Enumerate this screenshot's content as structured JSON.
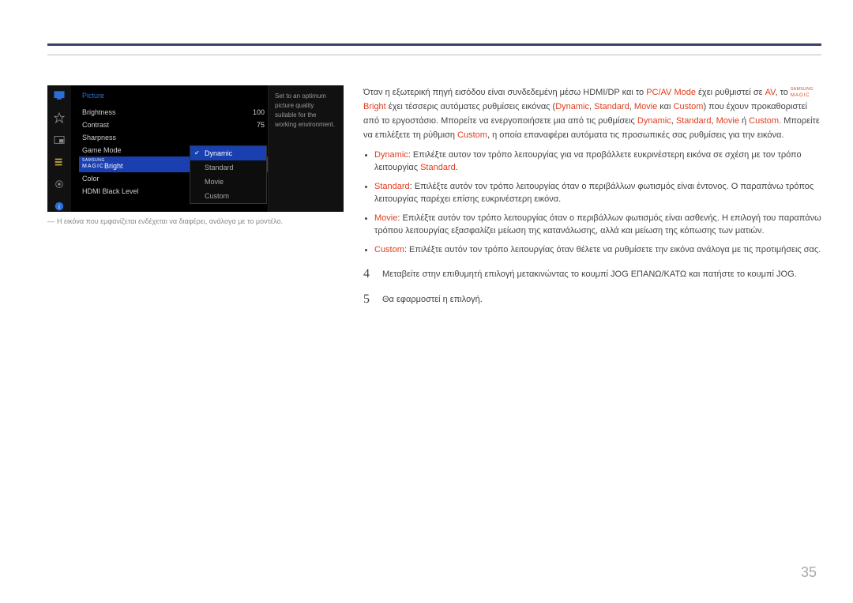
{
  "osd": {
    "title": "Picture",
    "items": [
      {
        "label": "Brightness",
        "value": "100"
      },
      {
        "label": "Contrast",
        "value": "75"
      },
      {
        "label": "Sharpness",
        "value": ""
      },
      {
        "label": "Game Mode",
        "value": ""
      },
      {
        "label_html": "magic",
        "label": "Bright",
        "value": "",
        "selected": true
      },
      {
        "label": "Color",
        "value": ""
      },
      {
        "label": "HDMI Black Level",
        "value": ""
      }
    ],
    "submenu": [
      "Dynamic",
      "Standard",
      "Movie",
      "Custom"
    ],
    "submenu_selected": 0,
    "hint": "Set to an optimum picture quality suitable for the working environment."
  },
  "caption": "Η εικόνα που εμφανίζεται ενδέχεται να διαφέρει, ανάλογα με το μοντέλο.",
  "intro": {
    "l1a": "Όταν η εξωτερική πηγή εισόδου είναι συνδεδεμένη μέσω HDMI/DP και το ",
    "l1b": "PC/AV Mode",
    "l1c": " έχει ρυθμιστεί σε ",
    "l1d": "AV",
    "l1e": ",",
    "l2a": "το ",
    "l2b": "Bright",
    "l2c": " έχει τέσσερις αυτόματες ρυθμίσεις εικόνας (",
    "l2d": "Dynamic",
    "l2e": ", ",
    "l2f": "Standard",
    "l2g": ", ",
    "l2h": "Movie",
    "l2i": " και ",
    "l2j": "Custom",
    "l2k": ") που έχουν",
    "l3a": "προκαθοριστεί από το εργοστάσιο. Μπορείτε να ενεργοποιήσετε μια από τις ρυθμίσεις ",
    "l3b": "Dynamic",
    "l3c": ", ",
    "l3d": "Standard",
    "l3e": ",",
    "l4a": "Movie",
    "l4b": " ή ",
    "l4c": "Custom",
    "l4d": ". Μπορείτε να επιλέξετε τη ρύθμιση ",
    "l4e": "Custom",
    "l4f": ", η οποία επαναφέρει αυτόματα τις προσωπικές σας",
    "l5": "ρυθμίσεις για την εικόνα."
  },
  "bullets": {
    "b1a": "Dynamic",
    "b1b": ": Επιλέξτε αυτον τον τρόπο λειτουργίας για να προβάλλετε ευκρινέστερη εικόνα σε σχέση με τον τρόπο λειτουργίας ",
    "b1c": "Standard",
    "b1d": ".",
    "b2a": "Standard",
    "b2b": ": Επιλέξτε αυτόν τον τρόπο λειτουργίας όταν ο περιβάλλων φωτισμός είναι έντονος. Ο παραπάνω τρόπος λειτουργίας παρέχει επίσης ευκρινέστερη εικόνα.",
    "b3a": "Movie",
    "b3b": ": Επιλέξτε αυτόν τον τρόπο λειτουργίας όταν ο περιβάλλων φωτισμός είναι ασθενής. Η επιλογή του παραπάνω τρόπου λειτουργίας εξασφαλίζει μείωση της κατανάλωσης, αλλά και μείωση της κόπωσης των ματιών.",
    "b4a": "Custom",
    "b4b": ": Επιλέξτε αυτόν τον τρόπο λειτουργίας όταν θέλετε να ρυθμίσετε την εικόνα ανάλογα με τις προτιμήσεις σας."
  },
  "steps": {
    "s4num": "4",
    "s4": "Μεταβείτε στην επιθυμητή επιλογή μετακινώντας το κουμπί JOG ΕΠΑΝΩ/ΚΑΤΩ και πατήστε το κουμπί JOG.",
    "s5num": "5",
    "s5": "Θα εφαρμοστεί η επιλογή."
  },
  "pagenum": "35"
}
